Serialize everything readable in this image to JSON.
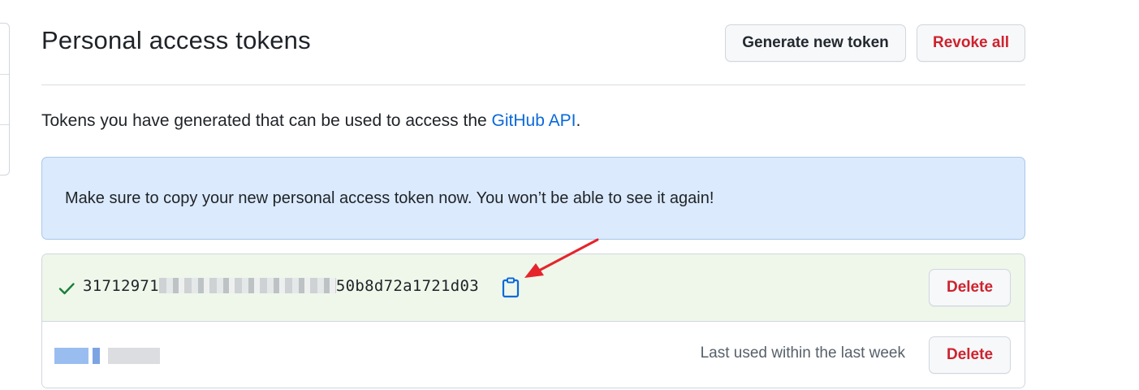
{
  "page": {
    "title": "Personal access tokens",
    "intro_prefix": "Tokens you have generated that can be used to access the ",
    "intro_link": "GitHub API",
    "intro_suffix": "."
  },
  "header_actions": {
    "generate_label": "Generate new token",
    "revoke_label": "Revoke all"
  },
  "flash": {
    "message": "Make sure to copy your new personal access token now. You won’t be able to see it again!"
  },
  "tokens": [
    {
      "value_start": "31712971",
      "value_end": "50b8d72a1721d03",
      "status_icon": "check-icon",
      "copy_icon": "clipboard-icon",
      "delete_label": "Delete"
    },
    {
      "last_used": "Last used within the last week",
      "delete_label": "Delete"
    }
  ],
  "colors": {
    "accent": "#0969da",
    "danger": "#cf222e",
    "success": "#1a7f37",
    "flash_bg": "#dbeafc",
    "new_token_bg": "#eef7ea",
    "annotation_arrow": "#e5242b"
  }
}
